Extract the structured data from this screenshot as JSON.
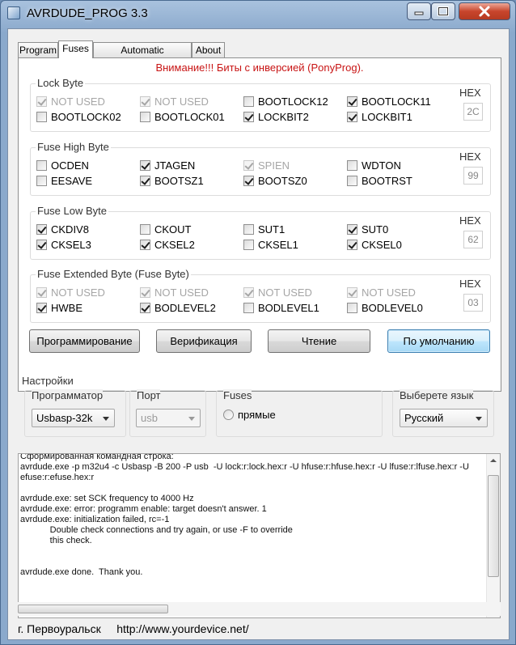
{
  "window": {
    "title": "AVRDUDE_PROG 3.3"
  },
  "tabs": [
    {
      "label": "Program"
    },
    {
      "label": "Fuses"
    },
    {
      "label": "Automatic programming"
    },
    {
      "label": "About"
    }
  ],
  "warning": "Внимание!!! Биты с инверсией (PonyProg).",
  "hex_label": "HEX",
  "lock_byte": {
    "title": "Lock Byte",
    "bits": [
      {
        "label": "NOT USED",
        "checked": true,
        "disabled": true
      },
      {
        "label": "NOT USED",
        "checked": true,
        "disabled": true
      },
      {
        "label": "BOOTLOCK12",
        "checked": false,
        "disabled": false
      },
      {
        "label": "BOOTLOCK11",
        "checked": true,
        "disabled": false
      },
      {
        "label": "BOOTLOCK02",
        "checked": false,
        "disabled": false
      },
      {
        "label": "BOOTLOCK01",
        "checked": false,
        "disabled": false
      },
      {
        "label": "LOCKBIT2",
        "checked": true,
        "disabled": false
      },
      {
        "label": "LOCKBIT1",
        "checked": true,
        "disabled": false
      }
    ],
    "hex": "2C"
  },
  "fuse_high": {
    "title": "Fuse High Byte",
    "bits": [
      {
        "label": "OCDEN",
        "checked": false,
        "disabled": false
      },
      {
        "label": "JTAGEN",
        "checked": true,
        "disabled": false
      },
      {
        "label": "SPIEN",
        "checked": true,
        "disabled": true
      },
      {
        "label": "WDTON",
        "checked": false,
        "disabled": false
      },
      {
        "label": "EESAVE",
        "checked": false,
        "disabled": false
      },
      {
        "label": "BOOTSZ1",
        "checked": true,
        "disabled": false
      },
      {
        "label": "BOOTSZ0",
        "checked": true,
        "disabled": false
      },
      {
        "label": "BOOTRST",
        "checked": false,
        "disabled": false
      }
    ],
    "hex": "99"
  },
  "fuse_low": {
    "title": "Fuse Low Byte",
    "bits": [
      {
        "label": "CKDIV8",
        "checked": true,
        "disabled": false
      },
      {
        "label": "CKOUT",
        "checked": false,
        "disabled": false
      },
      {
        "label": "SUT1",
        "checked": false,
        "disabled": false
      },
      {
        "label": "SUT0",
        "checked": true,
        "disabled": false
      },
      {
        "label": "CKSEL3",
        "checked": true,
        "disabled": false
      },
      {
        "label": "CKSEL2",
        "checked": true,
        "disabled": false
      },
      {
        "label": "CKSEL1",
        "checked": false,
        "disabled": false
      },
      {
        "label": "CKSEL0",
        "checked": true,
        "disabled": false
      }
    ],
    "hex": "62"
  },
  "fuse_ext": {
    "title": "Fuse Extended Byte (Fuse Byte)",
    "bits": [
      {
        "label": "NOT USED",
        "checked": true,
        "disabled": true
      },
      {
        "label": "NOT USED",
        "checked": true,
        "disabled": true
      },
      {
        "label": "NOT USED",
        "checked": true,
        "disabled": true
      },
      {
        "label": "NOT USED",
        "checked": true,
        "disabled": true
      },
      {
        "label": "HWBE",
        "checked": true,
        "disabled": false
      },
      {
        "label": "BODLEVEL2",
        "checked": true,
        "disabled": false
      },
      {
        "label": "BODLEVEL1",
        "checked": false,
        "disabled": false
      },
      {
        "label": "BODLEVEL0",
        "checked": false,
        "disabled": false
      }
    ],
    "hex": "03"
  },
  "buttons": {
    "program": "Программирование",
    "verify": "Верификация",
    "read": "Чтение",
    "default": "По умолчанию"
  },
  "settings": {
    "title": "Настройки",
    "programmer_label": "Программатор",
    "programmer_value": "Usbasp-32k",
    "port_label": "Порт",
    "port_value": "usb",
    "fuses_label": "Fuses",
    "fuses_option": "прямые",
    "language_label": "Выберете язык",
    "language_value": "Русский"
  },
  "log": [
    "Сформированная командная строка:",
    "avrdude.exe -p m32u4 -c Usbasp -B 200 -P usb  -U lock:r:lock.hex:r -U hfuse:r:hfuse.hex:r -U lfuse:r:lfuse.hex:r -U",
    "efuse:r:efuse.hex:r",
    "",
    "avrdude.exe: set SCK frequency to 4000 Hz",
    "avrdude.exe: error: programm enable: target doesn't answer. 1",
    "avrdude.exe: initialization failed, rc=-1",
    "            Double check connections and try again, or use -F to override",
    "            this check.",
    "",
    "",
    "avrdude.exe done.  Thank you."
  ],
  "footer": {
    "city": "г. Первоуральск",
    "url": "http://www.yourdevice.net/"
  }
}
